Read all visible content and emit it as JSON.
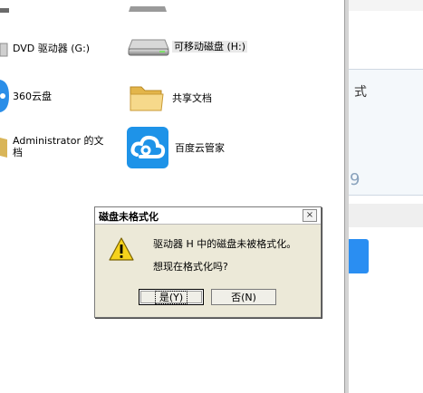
{
  "explorer": {
    "items": [
      {
        "label": "DVD 驱动器 (G:)"
      },
      {
        "label": "可移动磁盘 (H:)"
      },
      {
        "label": "360云盘"
      },
      {
        "label": "共享文档"
      },
      {
        "label": "Administrator 的文档"
      },
      {
        "label": "百度云管家"
      }
    ]
  },
  "right_panel": {
    "char": "式",
    "number": "9"
  },
  "dialog": {
    "title": "磁盘未格式化",
    "close_label": "×",
    "message_line1": "驱动器 H 中的磁盘未被格式化。",
    "message_line2": "想现在格式化吗?",
    "yes_label": "是(Y)",
    "no_label": "否(N)"
  },
  "colors": {
    "dialog_bg": "#ece9d8",
    "accent_blue": "#2a8ef2",
    "warning_yellow": "#f6d21c"
  },
  "icons": [
    "drive-icon",
    "removable-disk-icon",
    "cloud-360-icon",
    "folder-icon",
    "documents-icon",
    "baidu-cloud-icon",
    "warning-icon",
    "close-icon"
  ]
}
